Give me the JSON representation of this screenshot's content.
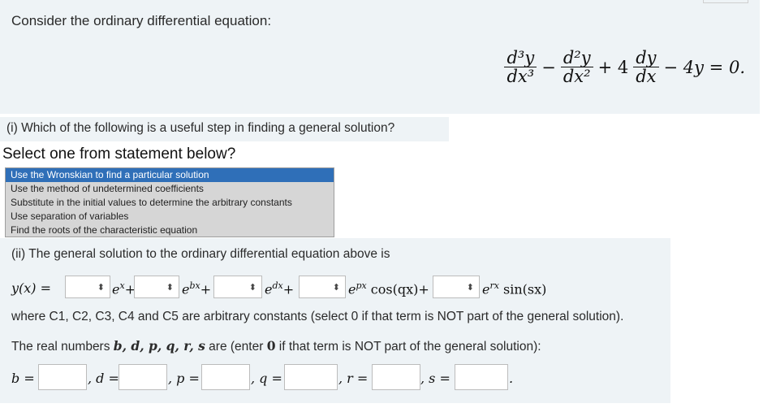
{
  "question": {
    "intro": "Consider the ordinary differential equation:",
    "equation": {
      "t1_num": "d³y",
      "t1_den": "dx³",
      "op1": "−",
      "t2_num": "d²y",
      "t2_den": "dx²",
      "op2": "+ 4",
      "t3_num": "dy",
      "t3_den": "dx",
      "tail": "− 4y = 0."
    }
  },
  "part_i": {
    "question": "(i) Which of the following is a useful step in finding a general solution?",
    "prompt": "Select one from statement below?",
    "options": [
      "Use the Wronskian to find a particular solution",
      "Use the method of undetermined coefficients",
      "Substitute in the initial values to determine the arbitrary constants",
      "Use separation of variables",
      "Find the roots of the characteristic equation"
    ],
    "selected_index": 0
  },
  "part_ii": {
    "question": "(ii) The general solution to the ordinary differential equation above is",
    "lhs": "y(x) =",
    "select_arrow": "⬍",
    "terms": {
      "t1": "e",
      "t1_sup": "x",
      "t1_op": "+",
      "t2": "e",
      "t2_sup": "bx",
      "t2_op": "+",
      "t3": "e",
      "t3_sup": "dx",
      "t3_op": "+",
      "t4": "e",
      "t4_sup": "px",
      "t4_fn": " cos(qx)",
      "t4_op": "+",
      "t5": "e",
      "t5_sup": "rx",
      "t5_fn": " sin(sx)"
    },
    "where_text": "where C1, C2, C3, C4 and C5 are arbitrary constants (select 0 if that term is NOT part of the general solution).",
    "real_prefix": "The real numbers ",
    "real_vars": "b, d, p, q, r, s",
    "real_mid": " are (enter ",
    "real_zero": "0",
    "real_suffix": " if that term is NOT part of the general solution):",
    "params": [
      {
        "label": "b =",
        "value": ""
      },
      {
        "label": ", d =",
        "value": ""
      },
      {
        "label": ", p =",
        "value": ""
      },
      {
        "label": ", q =",
        "value": ""
      },
      {
        "label": ", r =",
        "value": ""
      },
      {
        "label": ", s =",
        "value": ""
      }
    ],
    "end_punct": "."
  }
}
